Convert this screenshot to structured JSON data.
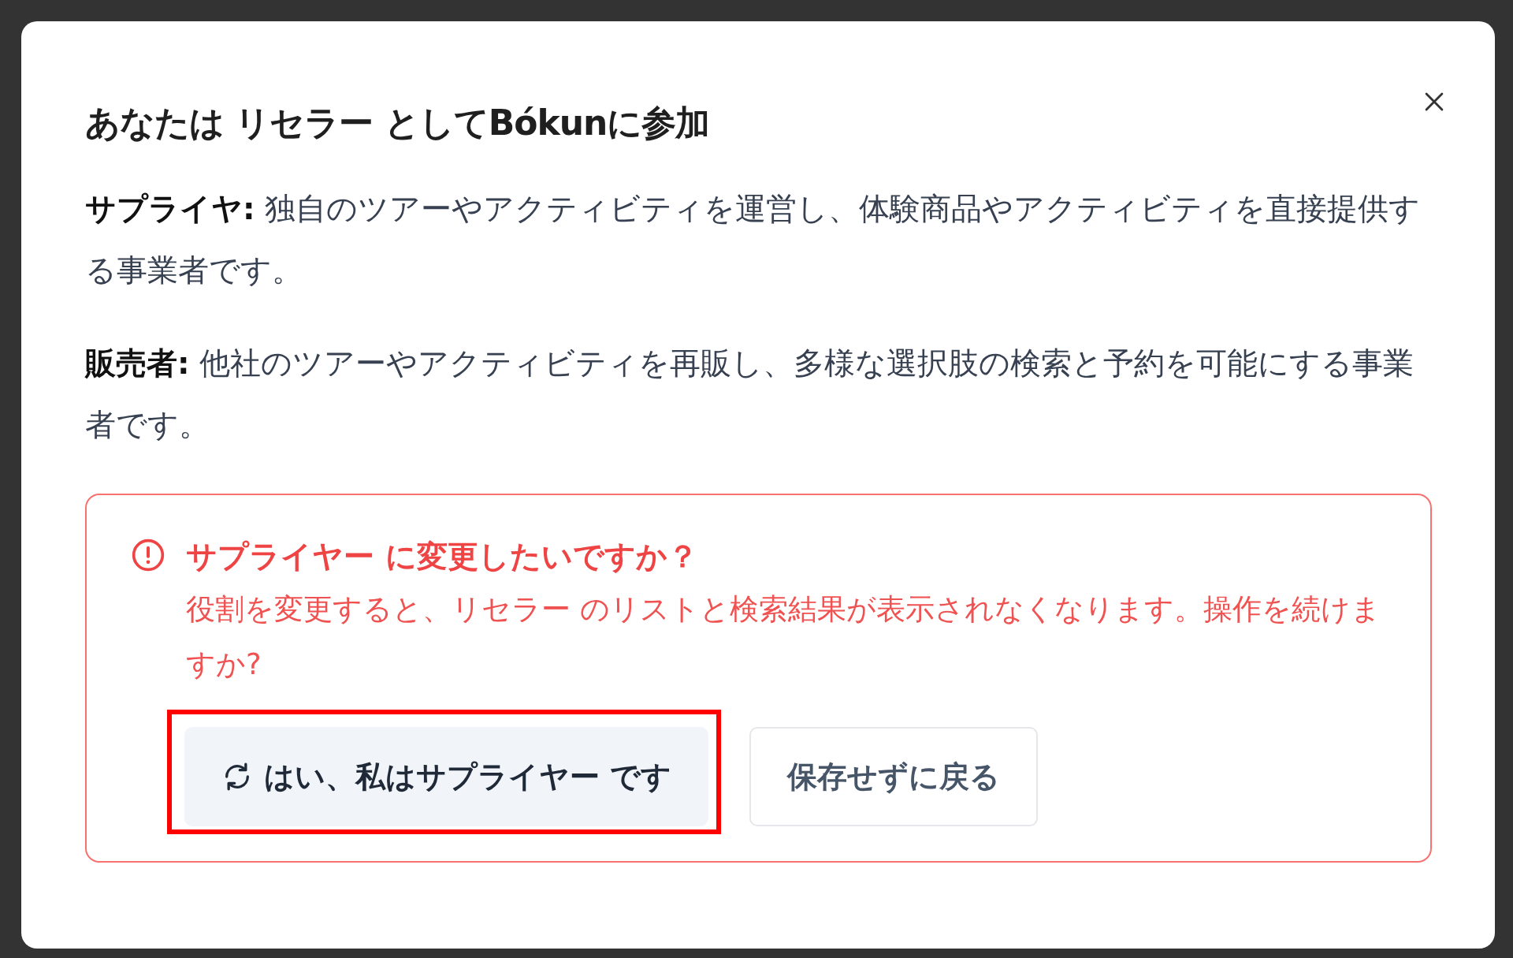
{
  "dialog": {
    "title": "あなたは リセラー としてBókunに参加",
    "paragraphs": [
      "**サプライヤ:** 独自のツアーやアクティビティを運営し、体験商品やアクティビティを直接提供する事業者です。",
      "**販売者:** 他社のツアーやアクティビティを再販し、多様な選択肢の検索と予約を可能にする事業者です。"
    ],
    "alert": {
      "title": "サプライヤー に変更したいですか？",
      "message": "役割を変更すると、リセラー のリストと検索結果が表示されなくなります。操作を続けますか?",
      "buttons": [
        {
          "kind": "confirm",
          "label": "はい、私はサプライヤー です",
          "highlighted": true
        },
        {
          "kind": "cancel",
          "label": "保存せずに戻る",
          "highlighted": false
        }
      ]
    }
  }
}
